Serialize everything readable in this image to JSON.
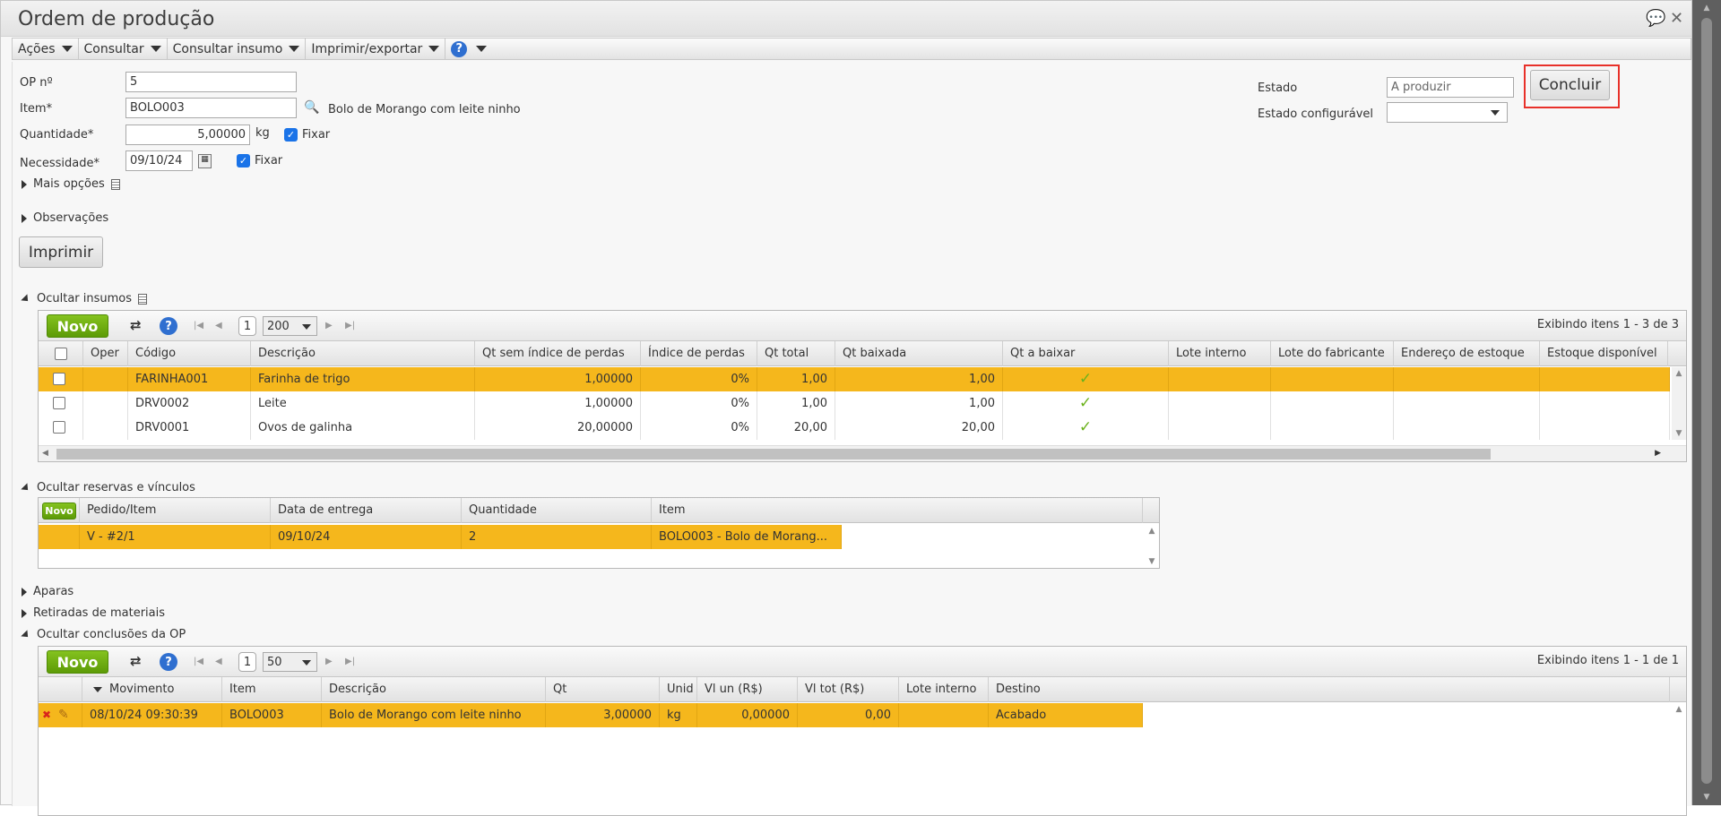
{
  "window": {
    "title": "Ordem de produção"
  },
  "menu": {
    "acoes": "Ações",
    "consultar": "Consultar",
    "consultar_insumo": "Consultar insumo",
    "imprimir_exportar": "Imprimir/exportar",
    "help": "?"
  },
  "form": {
    "op_label": "OP nº",
    "op_value": "5",
    "item_label": "Item*",
    "item_value": "BOLO003",
    "item_desc": "Bolo de Morango com leite ninho",
    "qtd_label": "Quantidade*",
    "qtd_value": "5,00000",
    "qtd_unit": "kg",
    "fixar1": "Fixar",
    "necessidade_label": "Necessidade*",
    "necessidade_value": "09/10/24",
    "fixar2": "Fixar",
    "mais_opcoes": "Mais opções",
    "observacoes": "Observações",
    "imprimir": "Imprimir",
    "estado_label": "Estado",
    "estado_value": "A produzir",
    "estado_conf_label": "Estado configurável",
    "estado_conf_value": "",
    "concluir": "Concluir"
  },
  "insumos": {
    "section": "Ocultar insumos",
    "novo": "Novo",
    "page": "1",
    "page_size": "200",
    "info": "Exibindo itens 1 - 3 de 3",
    "columns": [
      "Oper",
      "Código",
      "Descrição",
      "Qt sem índice de perdas",
      "Índice de perdas",
      "Qt total",
      "Qt baixada",
      "Qt a baixar",
      "Lote interno",
      "Lote do fabricante",
      "Endereço de estoque",
      "Estoque disponível"
    ],
    "rows": [
      {
        "codigo": "FARINHA001",
        "descricao": "Farinha de trigo",
        "qt_sem": "1,00000",
        "indice": "0%",
        "qt_total": "1,00",
        "qt_baixada": "1,00"
      },
      {
        "codigo": "DRV0002",
        "descricao": "Leite",
        "qt_sem": "1,00000",
        "indice": "0%",
        "qt_total": "1,00",
        "qt_baixada": "1,00"
      },
      {
        "codigo": "DRV0001",
        "descricao": "Ovos de galinha",
        "qt_sem": "20,00000",
        "indice": "0%",
        "qt_total": "20,00",
        "qt_baixada": "20,00"
      }
    ]
  },
  "reservas": {
    "section": "Ocultar reservas e vínculos",
    "novo": "Novo",
    "columns": [
      "Pedido/Item",
      "Data de entrega",
      "Quantidade",
      "Item"
    ],
    "rows": [
      {
        "pedido": "V - #2/1",
        "data": "09/10/24",
        "quantidade": "2",
        "item": "BOLO003 - Bolo de Morang..."
      }
    ]
  },
  "sections": {
    "aparas": "Aparas",
    "retiradas": "Retiradas de materiais"
  },
  "conclusoes": {
    "section": "Ocultar conclusões da OP",
    "novo": "Novo",
    "page": "1",
    "page_size": "50",
    "info": "Exibindo itens 1 - 1 de 1",
    "columns": [
      "Movimento",
      "Item",
      "Descrição",
      "Qt",
      "Unid",
      "Vl un (R$)",
      "Vl tot (R$)",
      "Lote interno",
      "Destino"
    ],
    "rows": [
      {
        "movimento": "08/10/24 09:30:39",
        "item": "BOLO003",
        "descricao": "Bolo de Morango com leite ninho",
        "qt": "3,00000",
        "unid": "kg",
        "vl_un": "0,00000",
        "vl_tot": "0,00",
        "lote": "",
        "destino": "Acabado"
      }
    ]
  }
}
